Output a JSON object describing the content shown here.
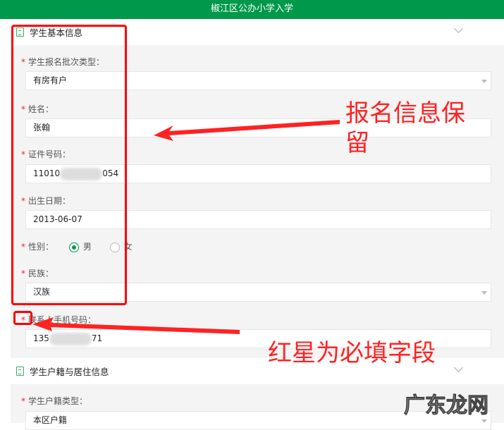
{
  "header": {
    "title": "椒江区公办小学入学"
  },
  "section1": {
    "title": "学生基本信息"
  },
  "fields": {
    "batch_type": {
      "label": "学生报名批次类型：",
      "value": "有房有户"
    },
    "name": {
      "label": "姓名：",
      "value": "张翰"
    },
    "id_number": {
      "label": "证件号码：",
      "value_start": "11010",
      "value_end": "054"
    },
    "birth": {
      "label": "出生日期：",
      "value": "2013-06-07"
    },
    "gender": {
      "label": "性别：",
      "options": [
        "男",
        "女"
      ],
      "selected": "男"
    },
    "ethnicity": {
      "label": "民族：",
      "value": "汉族"
    },
    "phone": {
      "label": "联系人手机号码：",
      "value_start": "135",
      "value_end": "71"
    },
    "hukou_type": {
      "label": "学生户籍类型：",
      "value": "本区户籍"
    }
  },
  "section2": {
    "title": "学生户籍与居住信息"
  },
  "required_mark": "*",
  "annotations": {
    "retain": "报名信息保留",
    "required": "红星为必填字段"
  },
  "watermark": "广东龙网"
}
